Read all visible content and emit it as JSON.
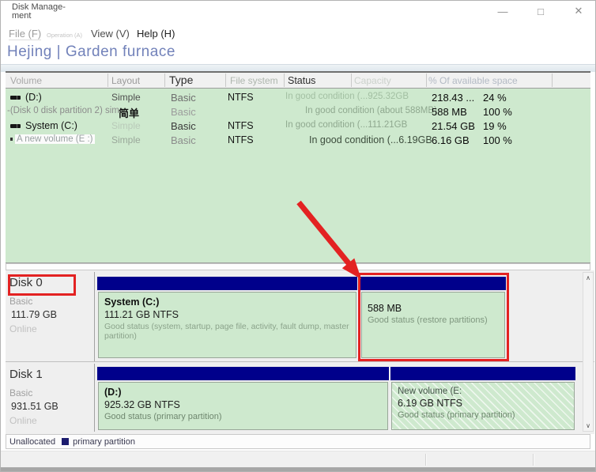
{
  "title_bar": {
    "title_lines": [
      "Disk Manage-",
      "ment"
    ]
  },
  "icons": {
    "minimize": "—",
    "maximize": "□",
    "close": "✕",
    "scroll_up": "∧",
    "scroll_down": "∨"
  },
  "menu_bar": {
    "file": "File (F)",
    "operation": "Operation (A)",
    "view": "View (V)",
    "help": "Help (H)"
  },
  "banner": "Hejing | Garden furnace",
  "volume_list": {
    "headers": {
      "volume": "Volume",
      "layout": "Layout",
      "type": "Type",
      "fs": "File system",
      "status": "Status",
      "capacity": "Capacity",
      "percent": "% Of available space"
    },
    "rows": [
      {
        "volume": "(D:)",
        "layout": "Simple",
        "type": "Basic",
        "fs": "NTFS",
        "status": "In good condition (...925.32GB",
        "capacity": "218.43 ...",
        "percent": "24 %"
      },
      {
        "volume": "-(Disk 0 disk partition 2) sim",
        "layout": "简单",
        "type": "Basic",
        "fs": "",
        "status": "In good condition (about 588MB)",
        "capacity": "588 MB",
        "percent": "100 %"
      },
      {
        "volume": "System (C:)",
        "layout": "Simple",
        "type": "Basic",
        "fs": "NTFS",
        "status": "In good condition (...111.21GB",
        "capacity": "21.54 GB",
        "percent": "19 %"
      },
      {
        "volume": "A new volume (E :)",
        "layout": "Simple",
        "type": "Basic",
        "fs": "NTFS",
        "status": "In good condition (...6.19GB",
        "capacity": "6.16 GB",
        "percent": "100 %"
      }
    ]
  },
  "disks": [
    {
      "name": "Disk 0",
      "kind": "Basic",
      "size": "111.79 GB",
      "state": "Online",
      "partitions": [
        {
          "name": "System  (C:)",
          "size": "111.21 GB NTFS",
          "status": "Good status (system, startup, page file, activity, fault dump, master partition)"
        },
        {
          "name": "",
          "size": "588 MB",
          "status": "Good status (restore partitions)"
        }
      ]
    },
    {
      "name": "Disk 1",
      "kind": "Basic",
      "size": "931.51 GB",
      "state": "Online",
      "partitions": [
        {
          "name": "(D:)",
          "size": "925.32 GB NTFS",
          "status": "Good status (primary partition)"
        },
        {
          "name": "New volume (E:",
          "size": "6.19 GB NTFS",
          "status": "Good status (primary partition)"
        }
      ]
    }
  ],
  "legend": {
    "unallocated_label": "Unallocated",
    "primary_label": "primary partition"
  },
  "colors": {
    "partition_green": "#cee9ce",
    "navy_bar": "#00008b",
    "annotation_red": "#e32222",
    "banner_blue": "#7282ba"
  }
}
